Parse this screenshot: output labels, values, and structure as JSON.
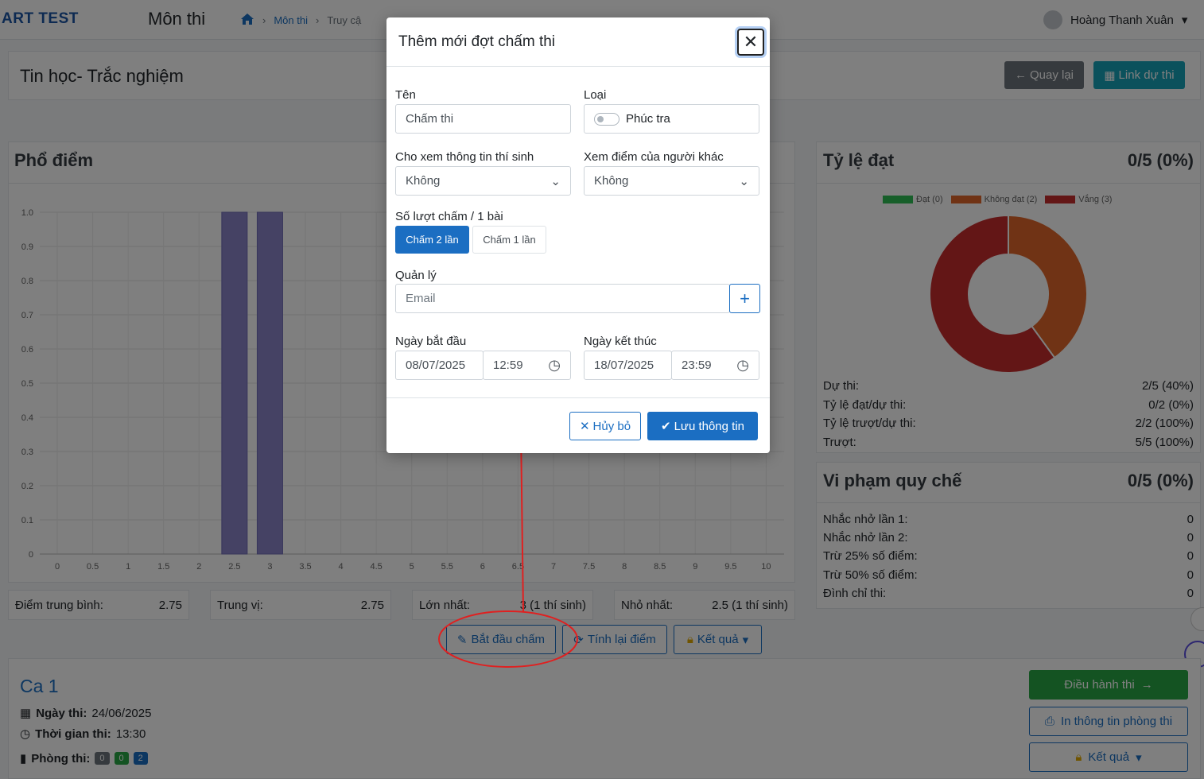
{
  "header": {
    "brand": "ART TEST",
    "page_title": "Môn thi",
    "breadcrumb": [
      "Môn thi",
      "Truy cậ"
    ],
    "user_name": "Hoàng Thanh Xuân"
  },
  "subject": {
    "title": "Tin học- Trắc nghiệm",
    "back_label": "Quay lại",
    "link_label": "Link dự thi"
  },
  "distribution": {
    "title": "Phổ điểm"
  },
  "chart_data": {
    "type": "bar",
    "categories": [
      "0",
      "0.5",
      "1",
      "1.5",
      "2",
      "2.5",
      "3",
      "3.5",
      "4",
      "4.5",
      "5",
      "5.5",
      "6",
      "6.5",
      "7",
      "7.5",
      "8",
      "8.5",
      "9",
      "9.5",
      "10"
    ],
    "values": [
      0,
      0,
      0,
      0,
      0,
      1,
      1,
      0,
      0,
      0,
      0,
      0,
      0,
      0,
      0,
      0,
      0,
      0,
      0,
      0,
      0
    ],
    "yticks": [
      "0",
      "0.1",
      "0.2",
      "0.3",
      "0.4",
      "0.5",
      "0.6",
      "0.7",
      "0.8",
      "0.9",
      "1.0"
    ],
    "ylim": [
      0,
      1
    ],
    "grid": true,
    "color": "#8a85c9"
  },
  "stats": {
    "avg_label": "Điểm trung bình:",
    "avg_value": "2.75",
    "median_label": "Trung vị:",
    "median_value": "2.75",
    "max_label": "Lớn nhất:",
    "max_value": "3 (1 thí sinh)",
    "min_label": "Nhỏ nhất:",
    "min_value": "2.5 (1 thí sinh)"
  },
  "actions": {
    "start_grading": "Bắt đầu chấm",
    "recalc": "Tính lại điểm",
    "result": "Kết quả"
  },
  "ratio": {
    "title": "Tỷ lệ đạt",
    "summary": "0/5 (0%)",
    "legend": [
      {
        "label": "Đạt (0)",
        "color": "#2fbf55"
      },
      {
        "label": "Không đạt (2)",
        "color": "#e0662a"
      },
      {
        "label": "Vắng (3)",
        "color": "#c62d2d"
      }
    ],
    "donut": [
      {
        "value": 0,
        "color": "#2fbf55"
      },
      {
        "value": 2,
        "color": "#e0662a"
      },
      {
        "value": 3,
        "color": "#c62d2d"
      }
    ],
    "rows": [
      {
        "label": "Dự thi:",
        "value": "2/5 (40%)"
      },
      {
        "label": "Tỷ lệ đạt/dự thi:",
        "value": "0/2 (0%)"
      },
      {
        "label": "Tỷ lệ trượt/dự thi:",
        "value": "2/2 (100%)"
      },
      {
        "label": "Trượt:",
        "value": "5/5 (100%)"
      }
    ]
  },
  "violation": {
    "title": "Vi phạm quy chế",
    "summary": "0/5 (0%)",
    "rows": [
      {
        "label": "Nhắc nhở lần 1:",
        "value": "0"
      },
      {
        "label": "Nhắc nhở lần 2:",
        "value": "0"
      },
      {
        "label": "Trừ 25% số điểm:",
        "value": "0"
      },
      {
        "label": "Trừ 50% số điểm:",
        "value": "0"
      },
      {
        "label": "Đình chỉ thi:",
        "value": "0"
      }
    ]
  },
  "session": {
    "title": "Ca 1",
    "date_label": "Ngày thi:",
    "date": "24/06/2025",
    "time_label": "Thời gian thi:",
    "time": "13:30",
    "room_label": "Phòng thi:",
    "room_badges": [
      "0",
      "0",
      "2"
    ],
    "manage_label": "Điều hành thi",
    "print_label": "In thông tin phòng thi",
    "result_label": "Kết quả"
  },
  "modal": {
    "title": "Thêm mới đợt chấm thi",
    "name_label": "Tên",
    "name_value": "Chấm thi",
    "type_label": "Loại",
    "type_toggle_label": "Phúc tra",
    "show_info_label": "Cho xem thông tin thí sinh",
    "show_info_value": "Không",
    "view_others_label": "Xem điểm của người khác",
    "view_others_value": "Không",
    "passes_label": "Số lượt chấm / 1 bài",
    "pass_two": "Chấm 2 lần",
    "pass_one": "Chấm 1 lần",
    "manager_label": "Quản lý",
    "manager_placeholder": "Email",
    "start_label": "Ngày bắt đầu",
    "start_date": "08/07/2025",
    "start_time": "12:59",
    "end_label": "Ngày kết thúc",
    "end_date": "18/07/2025",
    "end_time": "23:59",
    "cancel_label": "Hủy bỏ",
    "save_label": "Lưu thông tin"
  }
}
